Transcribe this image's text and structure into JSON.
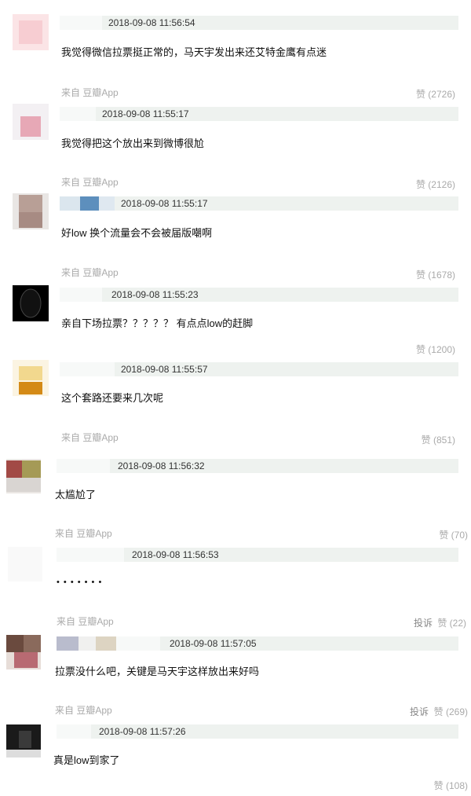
{
  "comments": [
    {
      "timestamp": "2018-09-08 11:56:54",
      "text": "我觉得微信拉票挺正常的，马天宇发出来还艾特金鹰有点迷",
      "source": "来自 豆瓣App",
      "like": "赞 (2726)"
    },
    {
      "timestamp": "2018-09-08 11:55:17",
      "text": "我觉得把这个放出来到微博很尬",
      "source": "来自 豆瓣App",
      "like": "赞 (2126)"
    },
    {
      "timestamp": "2018-09-08 11:55:17",
      "text": "好low 换个流量会不会被届版嘲啊",
      "source": "来自 豆瓣App",
      "like": "赞 (1678)"
    },
    {
      "timestamp": "2018-09-08 11:55:23",
      "text": "亲自下场拉票？？？？？ 有点点low的赶脚",
      "source": "",
      "like": "赞 (1200)"
    },
    {
      "timestamp": "2018-09-08 11:55:57",
      "text": "这个套路还要来几次呢",
      "source": "来自 豆瓣App",
      "like": "赞 (851)"
    },
    {
      "timestamp": "2018-09-08 11:56:32",
      "text": "太尴尬了",
      "source": "来自 豆瓣App",
      "like": "赞 (70)"
    },
    {
      "timestamp": "2018-09-08 11:56:53",
      "text": "• • • • • • •",
      "source": "来自 豆瓣App",
      "report": "投诉",
      "like": "赞 (22)"
    },
    {
      "timestamp": "2018-09-08 11:57:05",
      "text": "拉票没什么吧，关键是马天宇这样放出来好吗",
      "source": "来自 豆瓣App",
      "report": "投诉",
      "like": "赞 (269)"
    },
    {
      "timestamp": "2018-09-08 11:57:26",
      "text": "真是low到家了",
      "source": "",
      "like": "赞 (108)"
    }
  ],
  "colors": {
    "header_bg": "#eef2ef",
    "muted_text": "#aaaaaa",
    "body_text": "#111111"
  }
}
